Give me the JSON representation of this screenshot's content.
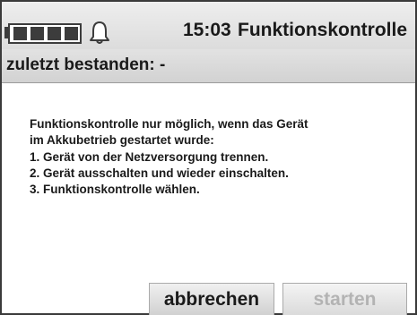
{
  "status_bar": {
    "battery_icon": "battery-icon",
    "battery_filled_bars": 4,
    "bell_icon": "bell-icon",
    "time": "15:03",
    "title": "Funktionskontrolle"
  },
  "subheader": {
    "last_passed": "zuletzt bestanden: -"
  },
  "message": {
    "line1": "Funktionskontrolle nur möglich, wenn das Gerät",
    "line2": "im Akkubetrieb gestartet wurde:",
    "line3": "1. Gerät von der Netzversorgung trennen.",
    "line4": "2. Gerät ausschalten und wieder einschalten.",
    "line5": "3. Funktionskontrolle wählen."
  },
  "buttons": {
    "cancel_label": "abbrechen",
    "start_label": "starten",
    "start_enabled": false
  },
  "colors": {
    "text": "#1a1a1a",
    "disabled_text": "#b3b3b3",
    "frame": "#3a3a3a"
  }
}
